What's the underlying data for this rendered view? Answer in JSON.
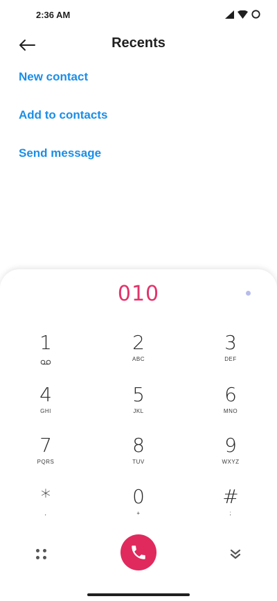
{
  "status_bar": {
    "time": "2:36 AM",
    "icons": [
      "signal-icon",
      "wifi-icon",
      "battery-icon"
    ]
  },
  "header": {
    "title": "Recents",
    "back_icon": "arrow-left-icon"
  },
  "actions": [
    {
      "label": "New contact"
    },
    {
      "label": "Add to contacts"
    },
    {
      "label": "Send message"
    }
  ],
  "dialer": {
    "number": "010",
    "accent_color": "#e02a5e",
    "keys": [
      {
        "digit": "1",
        "letters": ""
      },
      {
        "digit": "2",
        "letters": "ABC"
      },
      {
        "digit": "3",
        "letters": "DEF"
      },
      {
        "digit": "4",
        "letters": "GHI"
      },
      {
        "digit": "5",
        "letters": "JKL"
      },
      {
        "digit": "6",
        "letters": "MNO"
      },
      {
        "digit": "7",
        "letters": "PQRS"
      },
      {
        "digit": "8",
        "letters": "TUV"
      },
      {
        "digit": "9",
        "letters": "WXYZ"
      },
      {
        "digit": "*",
        "letters": ","
      },
      {
        "digit": "0",
        "letters": "+"
      },
      {
        "digit": "#",
        "letters": ";"
      }
    ],
    "bottom_icons": [
      "keypad-grid-icon",
      "phone-call-icon",
      "collapse-chevron-icon"
    ]
  },
  "colors": {
    "link": "#1a8ee8",
    "number": "#e2336b",
    "call_button": "#e02a5e"
  }
}
